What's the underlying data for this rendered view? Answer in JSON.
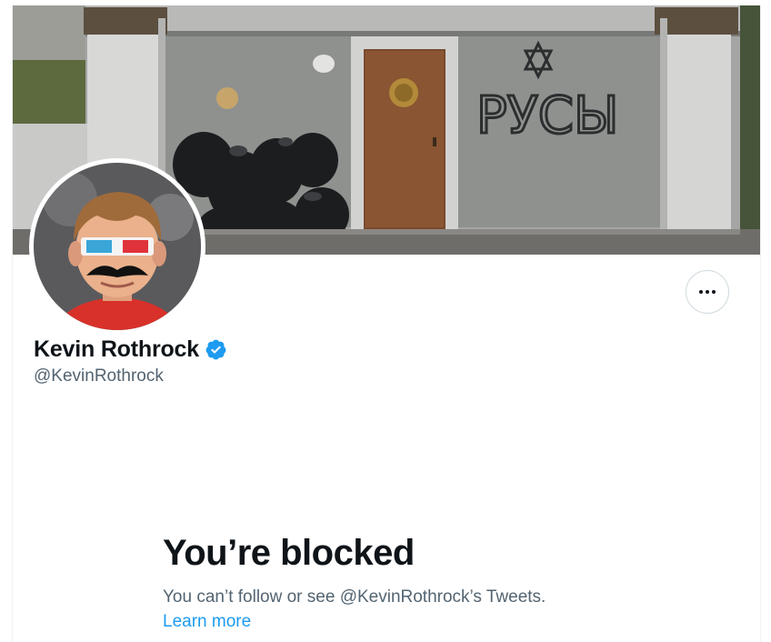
{
  "profile": {
    "display_name": "Kevin Rothrock",
    "handle": "@KevinRothrock",
    "verified": true,
    "verified_color": "#1d9bf0",
    "banner_graffiti": "РУСЫ",
    "banner_image": "building-entrance-with-garbage-bags-photo",
    "avatar_image": "boy-with-3d-glasses-and-mustache-photo"
  },
  "actions": {
    "more_icon": "more-horizontal-icon"
  },
  "blocked": {
    "title": "You’re blocked",
    "description": "You can’t follow or see @KevinRothrock’s Tweets.",
    "learn_more": "Learn more"
  },
  "colors": {
    "text_primary": "#0f1419",
    "text_secondary": "#536471",
    "link": "#1d9bf0",
    "border": "#cfd9de"
  }
}
